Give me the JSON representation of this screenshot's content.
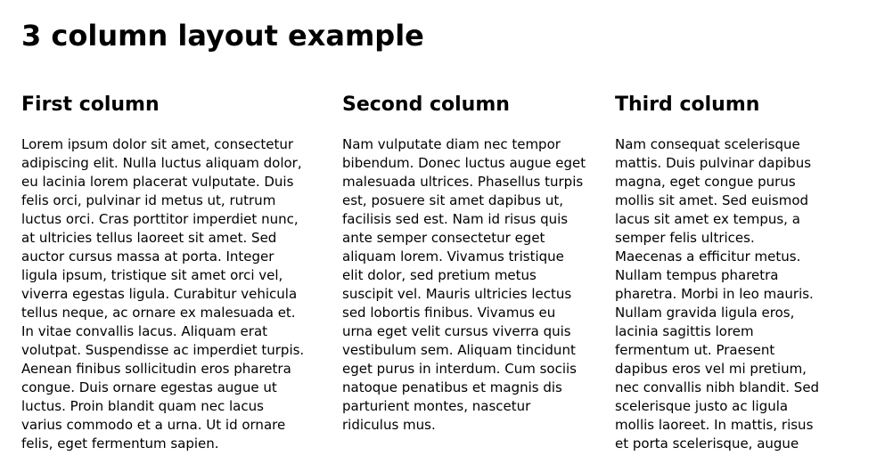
{
  "page": {
    "title": "3 column layout example"
  },
  "columns": [
    {
      "heading": "First column",
      "text": "Lorem ipsum dolor sit amet, consectetur adipiscing elit. Nulla luctus aliquam dolor, eu lacinia lorem placerat vulputate. Duis felis orci, pulvinar id metus ut, rutrum luctus orci. Cras porttitor imperdiet nunc, at ultricies tellus laoreet sit amet. Sed auctor cursus massa at porta. Integer ligula ipsum, tristique sit amet orci vel, viverra egestas ligula. Curabitur vehicula tellus neque, ac ornare ex malesuada et. In vitae convallis lacus. Aliquam erat volutpat. Suspendisse ac imperdiet turpis. Aenean finibus sollicitudin eros pharetra congue. Duis ornare egestas augue ut luctus. Proin blandit quam nec lacus varius commodo et a urna. Ut id ornare felis, eget fermentum sapien."
    },
    {
      "heading": "Second column",
      "text": "Nam vulputate diam nec tempor bibendum. Donec luctus augue eget malesuada ultrices. Phasellus turpis est, posuere sit amet dapibus ut, facilisis sed est. Nam id risus quis ante semper consectetur eget aliquam lorem. Vivamus tristique elit dolor, sed pretium metus suscipit vel. Mauris ultricies lectus sed lobortis finibus. Vivamus eu urna eget velit cursus viverra quis vestibulum sem. Aliquam tincidunt eget purus in interdum. Cum sociis natoque penatibus et magnis dis parturient montes, nascetur ridiculus mus."
    },
    {
      "heading": "Third column",
      "text": "Nam consequat scelerisque mattis. Duis pulvinar dapibus magna, eget congue purus mollis sit amet. Sed euismod lacus sit amet ex tempus, a semper felis ultrices. Maecenas a efficitur metus. Nullam tempus pharetra pharetra. Morbi in leo mauris. Nullam gravida ligula eros, lacinia sagittis lorem fermentum ut. Praesent dapibus eros vel mi pretium, nec convallis nibh blandit. Sed scelerisque justo ac ligula mollis laoreet. In mattis, risus et porta scelerisque, augue"
    }
  ]
}
